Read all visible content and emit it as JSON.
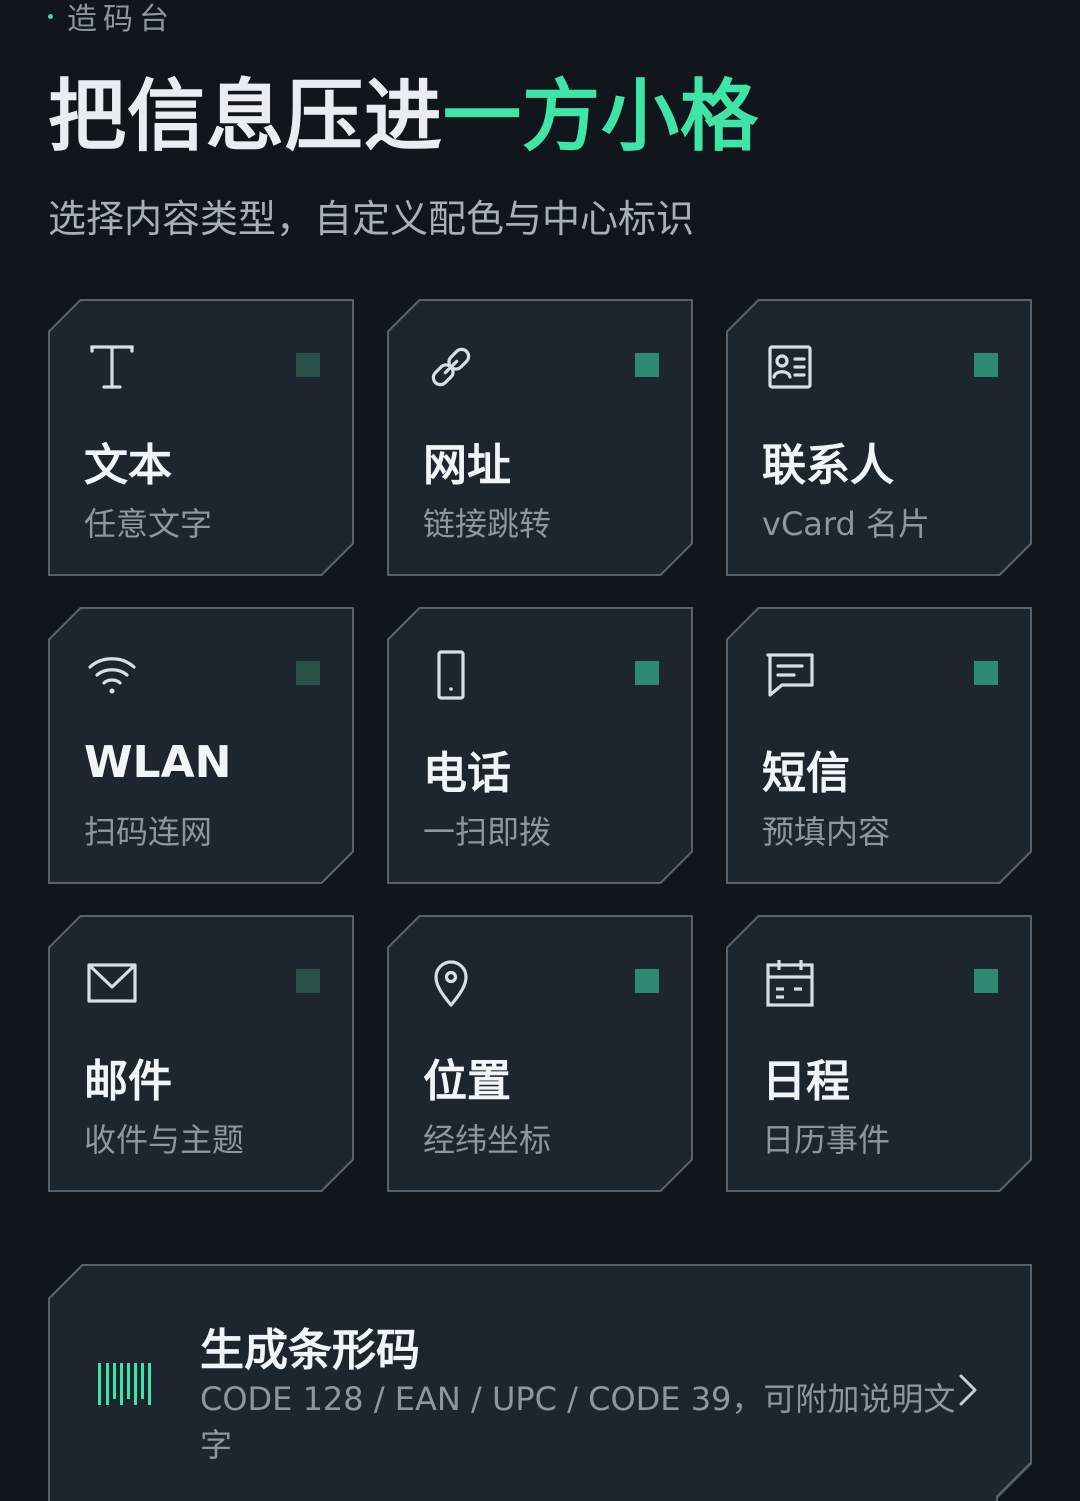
{
  "header": {
    "eyebrow": "造码台",
    "title_main": "把信息压进",
    "title_accent": "一方小格",
    "subtitle": "选择内容类型，自定义配色与中心标识"
  },
  "colors": {
    "accent": "#3ee5a6",
    "card_bg": "#1d252e",
    "card_border": "#59626b",
    "indicator_dim": "#285148",
    "indicator_bright": "#2e8a72"
  },
  "types": [
    {
      "icon": "text-icon",
      "label": "文本",
      "desc": "任意文字",
      "indicator": "dim"
    },
    {
      "icon": "link-icon",
      "label": "网址",
      "desc": "链接跳转",
      "indicator": "bright"
    },
    {
      "icon": "contact-card-icon",
      "label": "联系人",
      "desc": "vCard 名片",
      "indicator": "bright"
    },
    {
      "icon": "wifi-icon",
      "label": "WLAN",
      "desc": "扫码连网",
      "indicator": "dim"
    },
    {
      "icon": "phone-icon",
      "label": "电话",
      "desc": "一扫即拨",
      "indicator": "bright"
    },
    {
      "icon": "message-icon",
      "label": "短信",
      "desc": "预填内容",
      "indicator": "bright"
    },
    {
      "icon": "mail-icon",
      "label": "邮件",
      "desc": "收件与主题",
      "indicator": "dim"
    },
    {
      "icon": "location-pin-icon",
      "label": "位置",
      "desc": "经纬坐标",
      "indicator": "bright"
    },
    {
      "icon": "calendar-icon",
      "label": "日程",
      "desc": "日历事件",
      "indicator": "bright"
    }
  ],
  "barcode": {
    "icon": "barcode-icon",
    "title": "生成条形码",
    "desc": "CODE 128 / EAN / UPC / CODE 39，可附加说明文字"
  }
}
